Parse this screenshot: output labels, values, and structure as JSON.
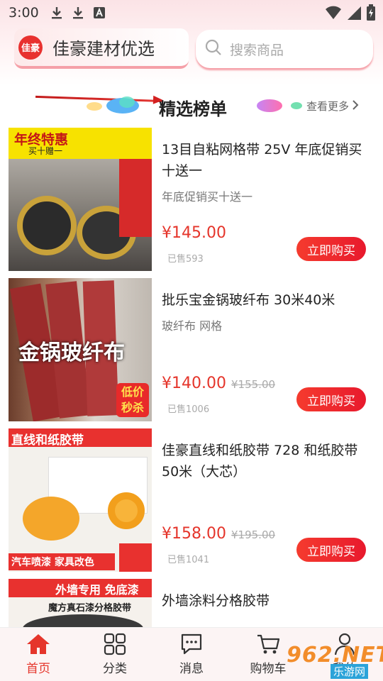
{
  "status_bar": {
    "time": "3:00"
  },
  "header": {
    "brand_logo_text": "佳豪",
    "brand_name": "佳豪建材优选",
    "search_placeholder": "搜索商品"
  },
  "section": {
    "title": "精选榜单",
    "more_label": "查看更多"
  },
  "products": [
    {
      "title": "13目自粘网格带 25V 年底促销买十送一",
      "subtitle": "年底促销买十送一",
      "price": "¥145.00",
      "old_price": "",
      "sold": "已售593",
      "buy_label": "立即购买",
      "thumb_banner": "年终特惠",
      "thumb_sub": "买十赠一"
    },
    {
      "title": "批乐宝金锅玻纤布 30米40米",
      "subtitle": "玻纤布 网格",
      "price": "¥140.00",
      "old_price": "¥155.00",
      "sold": "已售1006",
      "buy_label": "立即购买",
      "thumb_banner": "金锅玻纤布",
      "thumb_sub": "低价秒杀"
    },
    {
      "title": "佳豪直线和纸胶带 728 和纸胶带50米（大芯）",
      "subtitle": "",
      "price": "¥158.00",
      "old_price": "¥195.00",
      "sold": "已售1041",
      "buy_label": "立即购买",
      "thumb_banner": "直线和纸胶带",
      "thumb_sub": "汽车喷漆 家具改色"
    },
    {
      "title": "外墙涂料分格胶带",
      "subtitle": "",
      "price": "",
      "old_price": "",
      "sold": "",
      "buy_label": "",
      "thumb_banner": "外墙专用 免底漆",
      "thumb_sub": "魔方真石漆分格胶带"
    }
  ],
  "bottom_nav": [
    {
      "label": "首页",
      "icon": "home-icon",
      "active": true
    },
    {
      "label": "分类",
      "icon": "grid-icon",
      "active": false
    },
    {
      "label": "消息",
      "icon": "message-icon",
      "active": false
    },
    {
      "label": "购物车",
      "icon": "cart-icon",
      "active": false
    },
    {
      "label": "我的",
      "icon": "user-icon",
      "active": false
    }
  ],
  "watermark": {
    "top": "962.NET",
    "bottom": "乐游网"
  },
  "colors": {
    "accent": "#e5352b",
    "header_bg": "#fbe3e6"
  }
}
